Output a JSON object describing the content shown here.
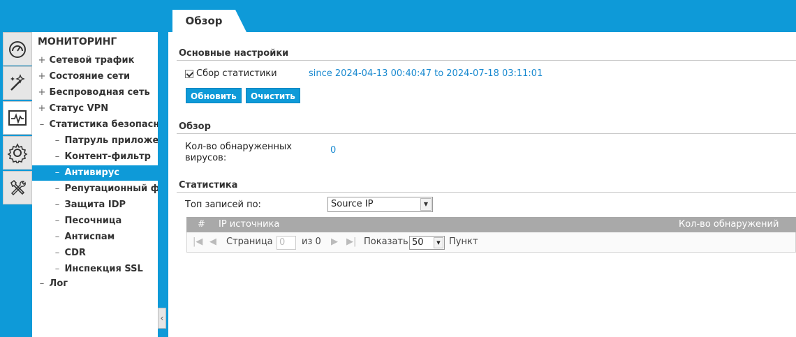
{
  "colors": {
    "accent": "#0e9ad8",
    "link": "#1a8ad0",
    "grid_header": "#a9a9a9"
  },
  "rail": {
    "icons": [
      "dashboard-icon",
      "wizard-icon",
      "monitor-icon",
      "settings-gear-icon",
      "tools-icon"
    ],
    "active": "monitor-icon"
  },
  "sidebar": {
    "title": "МОНИТОРИНГ",
    "items": [
      {
        "sym": "+",
        "label": "Сетевой трафик"
      },
      {
        "sym": "+",
        "label": "Состояние сети"
      },
      {
        "sym": "+",
        "label": "Беспроводная сеть"
      },
      {
        "sym": "+",
        "label": "Статус VPN"
      },
      {
        "sym": "–",
        "label": "Статистика безопасн"
      },
      {
        "sym": "–",
        "label": "Патруль приложе"
      },
      {
        "sym": "–",
        "label": "Контент-фильтр"
      },
      {
        "sym": "–",
        "label": "Антивирус"
      },
      {
        "sym": "–",
        "label": "Репутационный ф"
      },
      {
        "sym": "–",
        "label": "Защита IDP"
      },
      {
        "sym": "–",
        "label": "Песочница"
      },
      {
        "sym": "–",
        "label": "Антиспам"
      },
      {
        "sym": "–",
        "label": "CDR"
      },
      {
        "sym": "–",
        "label": "Инспекция SSL"
      },
      {
        "sym": "–",
        "label": "Лог"
      }
    ],
    "collapse_icon": "‹"
  },
  "tab": {
    "label": "Обзор"
  },
  "basic": {
    "title": "Основные настройки",
    "collect_label": "Сбор статистики",
    "collect_checked": true,
    "since_text": "since 2024-04-13 00:40:47 to 2024-07-18 03:11:01",
    "refresh_label": "Обновить",
    "clear_label": "Очистить"
  },
  "overview": {
    "title": "Обзор",
    "viruses_label_1": "Кол-во обнаруженных",
    "viruses_label_2": "вирусов:",
    "viruses_value": "0"
  },
  "stats": {
    "title": "Статистика",
    "top_label": "Топ записей по:",
    "top_value": "Source IP",
    "columns": [
      "#",
      "IP источника",
      "Кол-во обнаружений"
    ],
    "pager": {
      "page_label": "Страница",
      "page_value": "0",
      "of_label": "из 0",
      "show_label": "Показать",
      "page_size": "50",
      "unit_label": "Пункт"
    }
  }
}
